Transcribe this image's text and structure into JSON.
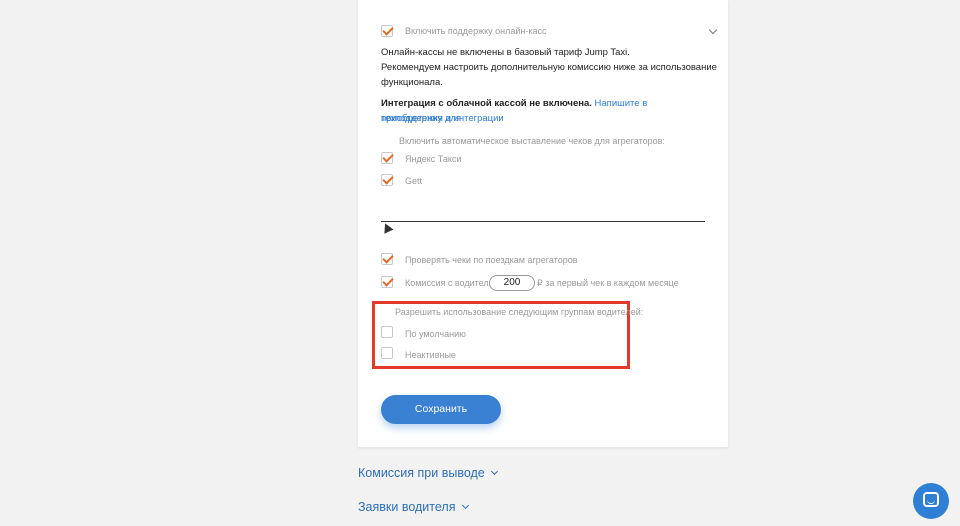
{
  "online_cash": {
    "toggle_label": "Включить поддержку онлайн-касс",
    "toggle_checked": true
  },
  "notice": {
    "line1": "Онлайн-кассы не включены в базовый тариф Jump Taxi.",
    "line2": "Рекомендуем настроить дополнительную комиссию ниже за использование",
    "line3": "функционала.",
    "integration_bold": "Интеграция с облачной кассой не включена.",
    "integration_link": "Напишите в техподдержку для",
    "integration_link2": "приобретения и интеграции"
  },
  "aggregators": {
    "heading": "Включить автоматическое выставление чеков для агрегаторов:",
    "items": [
      {
        "label": "Яндекс Такси",
        "checked": true
      },
      {
        "label": "Gett",
        "checked": true
      }
    ]
  },
  "options": {
    "check_receipts": {
      "label": "Проверять чеки по поездкам агрегаторов",
      "checked": true
    },
    "commission": {
      "label_before": "Комиссия с водителя",
      "value": "200",
      "label_after": "₽ за первый чек в каждом месяце",
      "checked": true
    }
  },
  "driver_groups": {
    "heading": "Разрешить использование следующим группам водителей:",
    "items": [
      {
        "label": "По умолчанию",
        "checked": false
      },
      {
        "label": "Неактивные",
        "checked": false
      }
    ]
  },
  "save_label": "Сохранить",
  "sections": [
    {
      "label": "Комиссия при выводе"
    },
    {
      "label": "Заявки водителя"
    }
  ],
  "colors": {
    "accent": "#e06b2a",
    "primary": "#3a80d3",
    "highlight": "#e23a2a"
  }
}
